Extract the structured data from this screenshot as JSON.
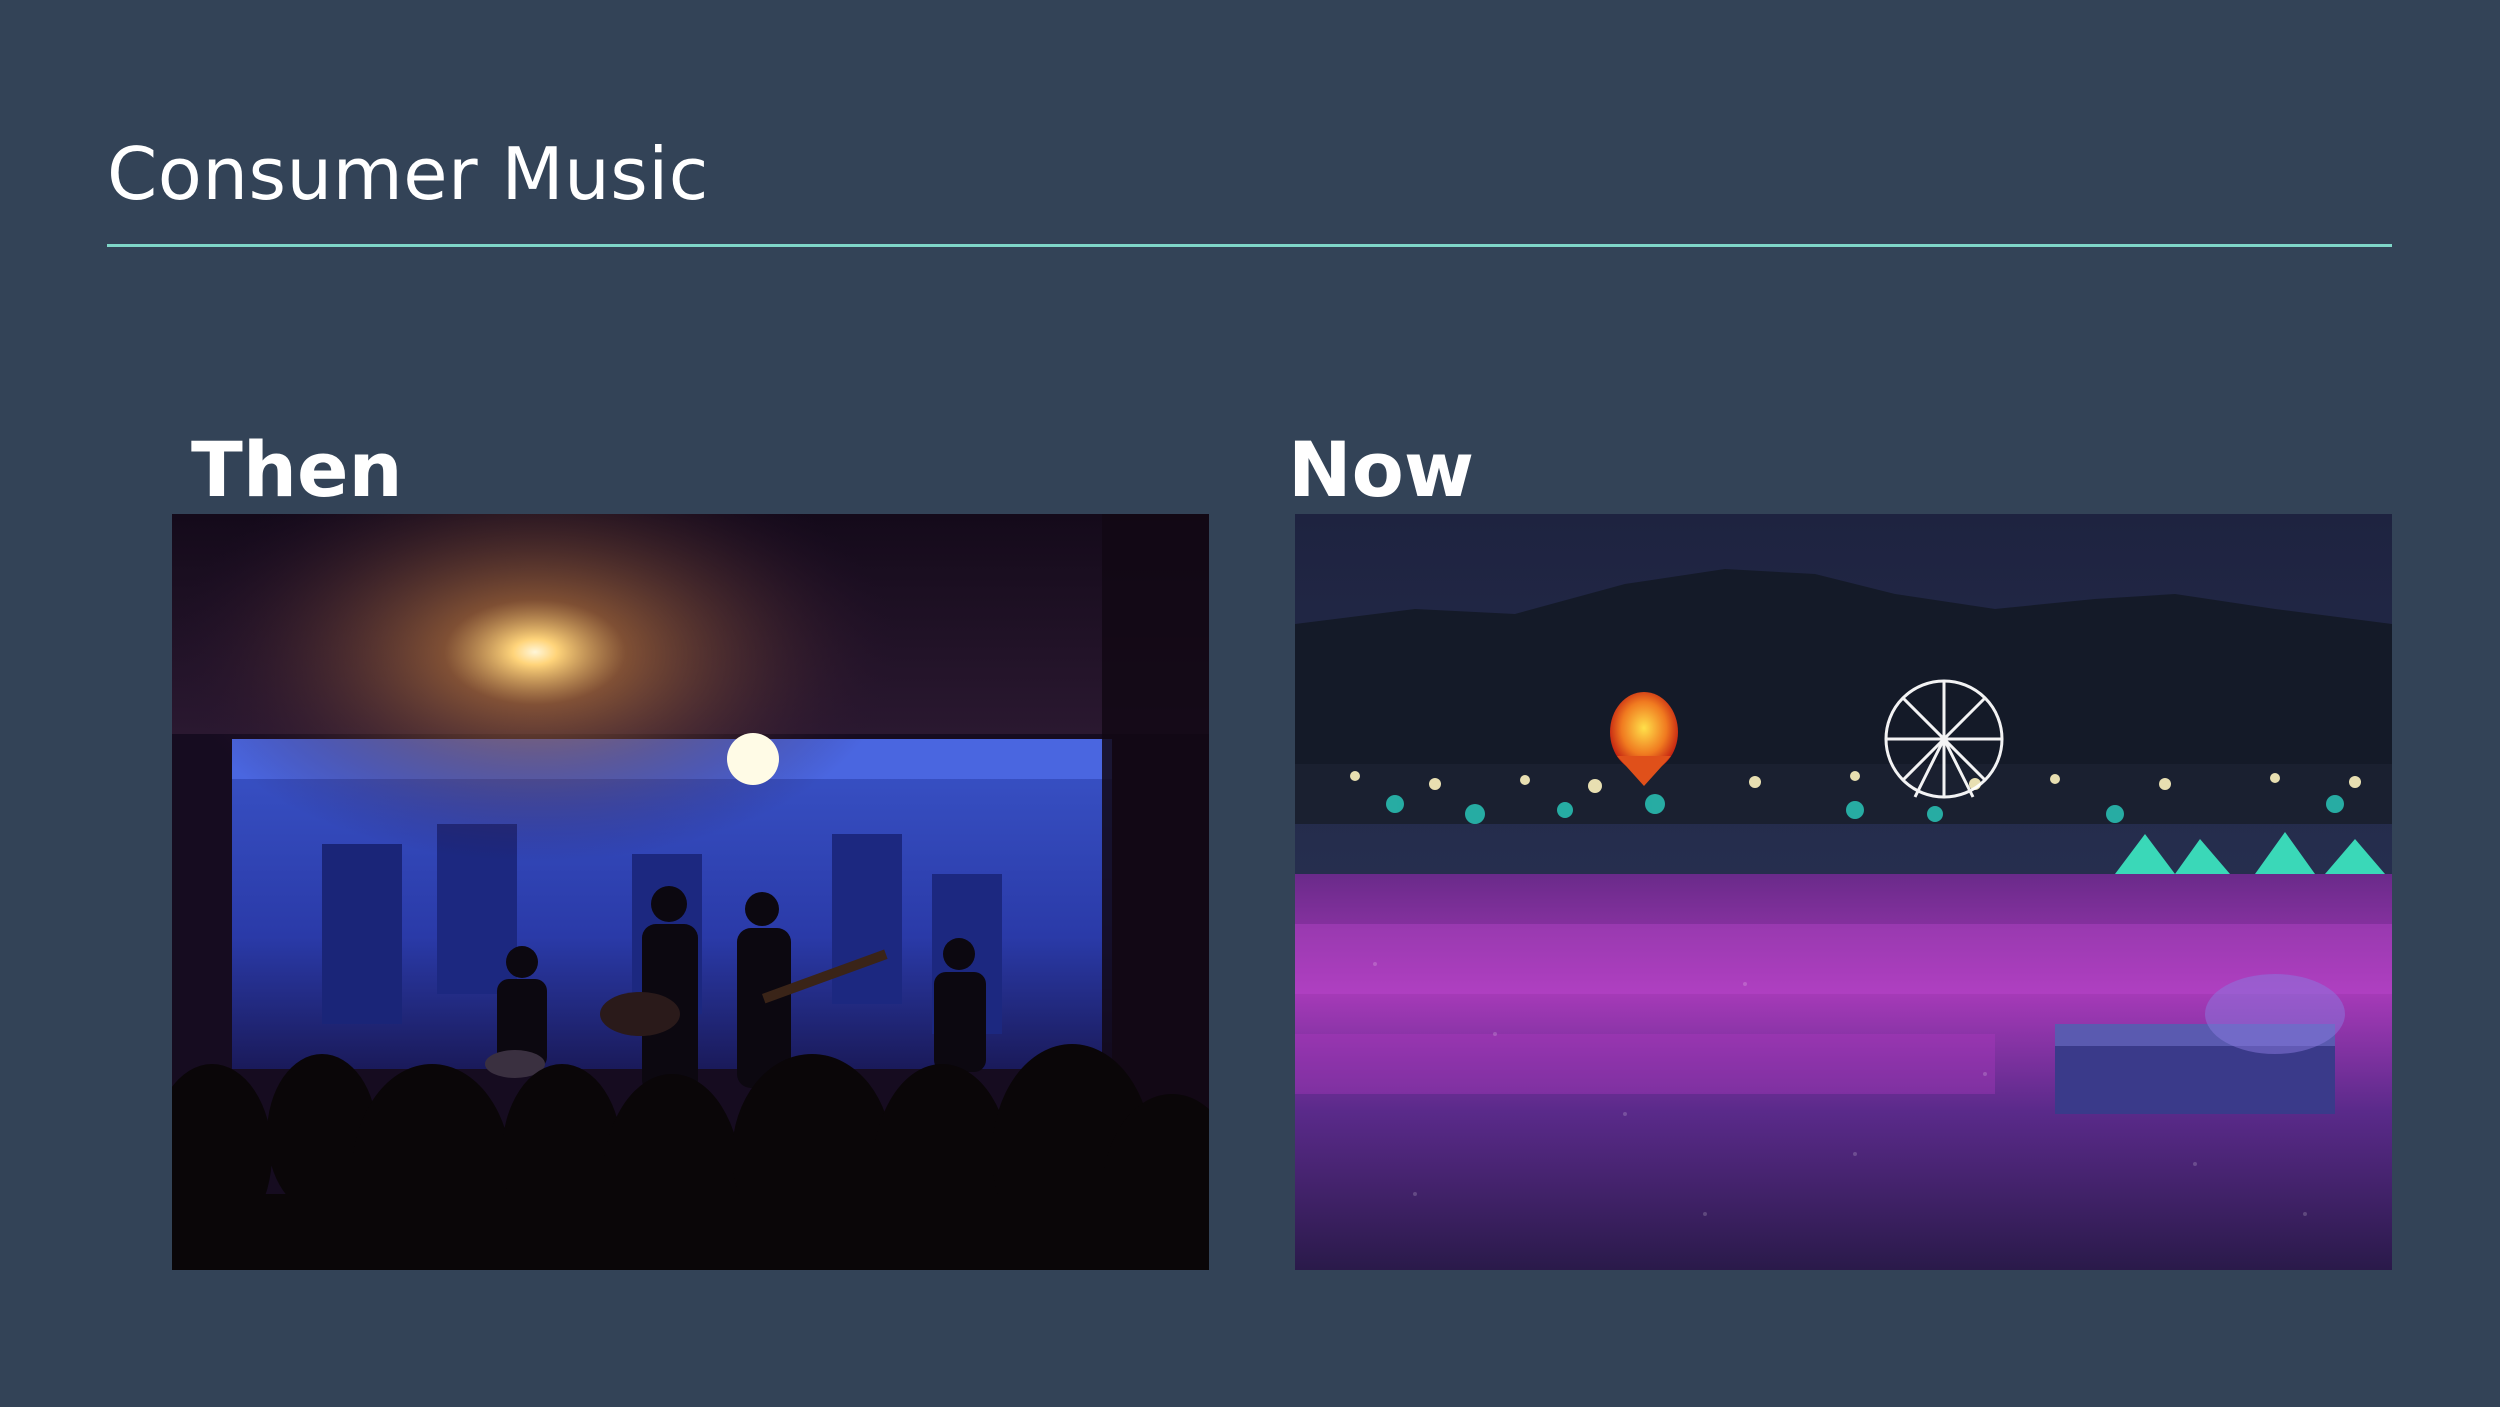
{
  "slide": {
    "title": "Consumer Music",
    "accent_color": "#7fd6c8",
    "background_color": "#334357"
  },
  "columns": [
    {
      "label": "Then",
      "image": "photo of small indoor club concert with band on stage lit by blue and warm spotlight"
    },
    {
      "label": "Now",
      "image": "photo of massive outdoor music festival at night with ferris wheel, hot air balloon and purple-lit crowd"
    }
  ]
}
